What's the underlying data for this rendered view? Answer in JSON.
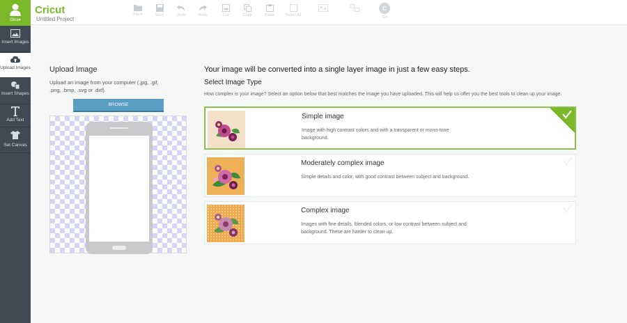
{
  "sidebar": {
    "user": {
      "name": "Gina",
      "chevron": "▾"
    },
    "items": [
      {
        "label": "Insert Images",
        "icon": "image-icon"
      },
      {
        "label": "Upload Images",
        "icon": "cloud-upload-icon"
      },
      {
        "label": "Insert Shapes",
        "icon": "shapes-icon"
      },
      {
        "label": "Add Text",
        "icon": "text-icon"
      },
      {
        "label": "Set Canvas",
        "icon": "tshirt-icon"
      }
    ]
  },
  "topbar": {
    "logo_text": "Cricut",
    "project_title": "Untitled Project",
    "tools": [
      {
        "label": "File ▾",
        "icon": "folder-icon"
      },
      {
        "label": "Save",
        "icon": "save-icon"
      },
      {
        "label": "Undo",
        "icon": "undo-icon"
      },
      {
        "label": "Redo",
        "icon": "redo-icon"
      },
      {
        "label": "Cut",
        "icon": "cut-icon"
      },
      {
        "label": "Copy",
        "icon": "copy-icon"
      },
      {
        "label": "Paste",
        "icon": "paste-icon"
      },
      {
        "label": "Select All",
        "icon": "select-all-icon"
      },
      {
        "label": "",
        "icon": "group-icon"
      },
      {
        "label": "",
        "icon": "ungroup-icon"
      },
      {
        "label": "Go",
        "icon": "go-icon"
      }
    ]
  },
  "upload": {
    "title": "Upload Image",
    "description": "Upload an image from your computer (.jpg, .gif, .png, .bmp, .svg or .dxf).",
    "browse_label": "BROWSE"
  },
  "main": {
    "heading": "Your image will be converted into a single layer image in just a few easy steps.",
    "subheading": "Select Image Type",
    "help": "How complex is your image? Select an option below that best matches the image you have uploaded. This will help us offer you the best tools to clean up your image.",
    "options": [
      {
        "title": "Simple image",
        "description": "Image with high contrast colors and with a transparent or mono-tone background.",
        "selected": true
      },
      {
        "title": "Moderately complex image",
        "description": "Simple details and color, with good contrast between subject and background.",
        "selected": false
      },
      {
        "title": "Complex image",
        "description": "Images with fine details, blended colors, or low contrast between subject and background. These are harder to clean up.",
        "selected": false
      }
    ]
  },
  "colors": {
    "brand_green": "#7ab829",
    "sidebar_bg": "#3f4a55",
    "browse_blue": "#5b9ec4",
    "selected_border": "#8bc34a"
  }
}
